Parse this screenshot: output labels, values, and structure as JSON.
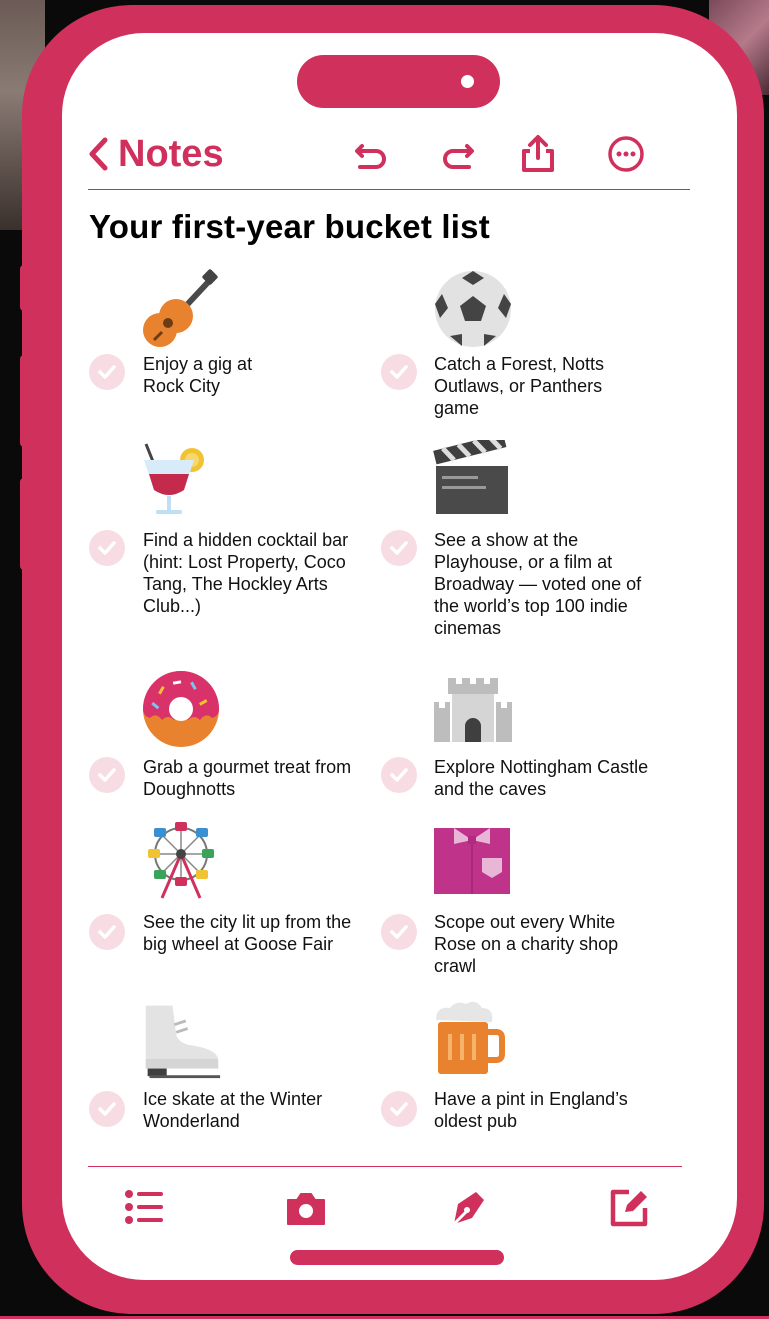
{
  "topbar": {
    "back_label": "Notes",
    "icons": [
      "undo-icon",
      "redo-icon",
      "share-icon",
      "more-icon"
    ]
  },
  "note": {
    "title": "Your first-year bucket list",
    "items": [
      {
        "text": "Enjoy a gig at Rock City",
        "icon": "guitar-icon"
      },
      {
        "text": "Catch a Forest, Notts Outlaws, or Panthers game",
        "icon": "football-icon"
      },
      {
        "text": "Find a hidden cocktail bar (hint: Lost Property, Coco Tang, The Hockley Arts Club...)",
        "icon": "cocktail-icon"
      },
      {
        "text": "See a show at the Playhouse, or a film at Broadway — voted one of the world’s top 100 indie cinemas",
        "icon": "clapperboard-icon"
      },
      {
        "text": "Grab a gourmet treat from Doughnotts",
        "icon": "doughnut-icon"
      },
      {
        "text": "Explore Nottingham Castle and the caves",
        "icon": "castle-icon"
      },
      {
        "text": "See the city lit up from the big wheel at Goose Fair",
        "icon": "ferris-wheel-icon"
      },
      {
        "text": "Scope out every White Rose on a charity shop crawl",
        "icon": "shirt-icon"
      },
      {
        "text": "Ice skate at the Winter Wonderland",
        "icon": "ice-skate-icon"
      },
      {
        "text": "Have a pint in England’s oldest pub",
        "icon": "beer-mug-icon"
      }
    ]
  },
  "bottombar": {
    "icons": [
      "checklist-icon",
      "camera-icon",
      "markup-pen-icon",
      "compose-icon"
    ]
  },
  "colors": {
    "accent": "#d0305c",
    "check_bg": "#f7dde3"
  }
}
